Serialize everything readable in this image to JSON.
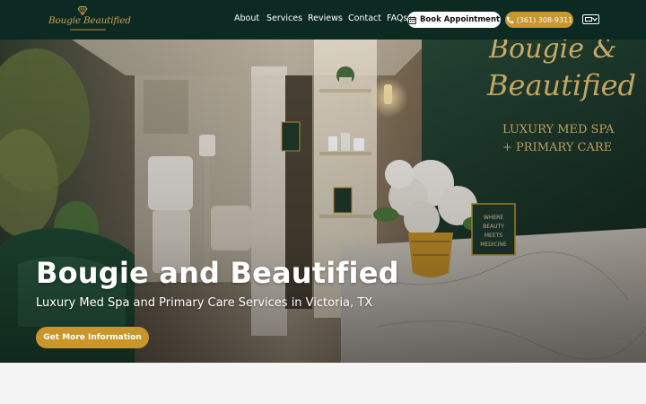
{
  "brand": {
    "logo_text": "Bougie Beautified",
    "logo_alt": "Bougie & Beautified logo"
  },
  "nav": {
    "items": [
      {
        "label": "About"
      },
      {
        "label": "Services"
      },
      {
        "label": "Reviews"
      },
      {
        "label": "Contact"
      },
      {
        "label": "FAQs"
      }
    ],
    "book_label": "Book Appointment",
    "phone_label": "(361) 308-9311",
    "language_icon": "flag-icon"
  },
  "hero": {
    "title": "Bougie and Beautified",
    "subtitle": "Luxury Med Spa and Primary Care Services in Victoria, TX",
    "cta_label": "Get More Information",
    "wall_sign_line1": "Bougie &",
    "wall_sign_line2": "Beautified",
    "wall_sign_line3": "LUXURY MED SPA",
    "wall_sign_line4": "+ PRIMARY CARE",
    "desk_sign_line1": "WHERE",
    "desk_sign_line2": "BEAUTY",
    "desk_sign_line3": "MEETS",
    "desk_sign_line4": "MEDICINE"
  },
  "colors": {
    "nav_bg": "#0d2a22",
    "accent_gold": "#c9962c",
    "wall_green": "#1d3b2f",
    "text_white": "#ffffff"
  }
}
